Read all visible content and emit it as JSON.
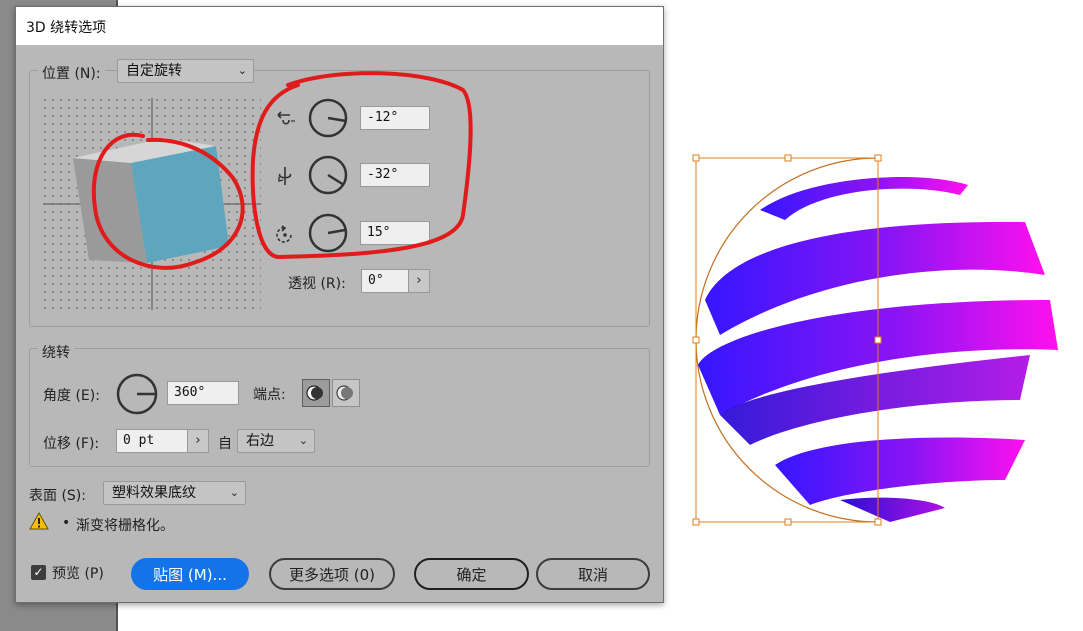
{
  "dialog": {
    "title": "3D 绕转选项",
    "position": {
      "label": "位置 (N):",
      "preset": "自定旋转",
      "x_rotation": "-12°",
      "y_rotation": "-32°",
      "z_rotation": "15°",
      "perspective_label": "透视 (R):",
      "perspective_value": "0°"
    },
    "revolve": {
      "group_label": "绕转",
      "angle_label": "角度 (E):",
      "angle_value": "360°",
      "cap_label": "端点:",
      "offset_label": "位移 (F):",
      "offset_value": "0 pt",
      "from_label": "自",
      "from_value": "右边"
    },
    "surface": {
      "label": "表面 (S):",
      "value": "塑料效果底纹"
    },
    "warning": {
      "bullet": "•",
      "text": "渐变将栅格化。"
    },
    "preview": {
      "label": "预览 (P)",
      "checked": true
    },
    "buttons": {
      "map_art": "贴图 (M)...",
      "more_options": "更多选项 (0)",
      "ok": "确定",
      "cancel": "取消"
    }
  },
  "colors": {
    "primary_button": "#1473e6",
    "annotation_red": "#e01b1b",
    "selection_orange": "#e07b1a",
    "cube_front": "#5ea6bd",
    "gradient_start": "#3b16ff",
    "gradient_end": "#ff10f0"
  },
  "icons": {
    "x_axis": "rotate-x-axis-icon",
    "y_axis": "rotate-y-axis-icon",
    "z_axis": "rotate-z-axis-icon",
    "warning": "warning-triangle-icon",
    "dropdown": "chevron-down-icon"
  }
}
